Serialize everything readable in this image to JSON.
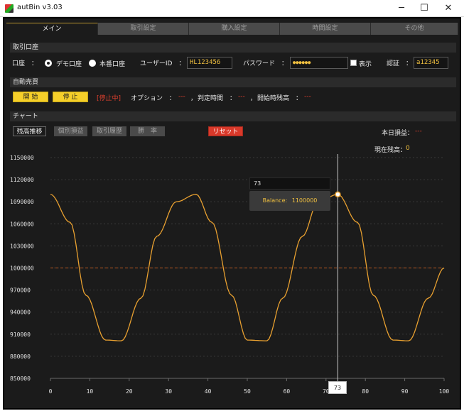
{
  "window": {
    "title": "autBin v3.03",
    "minimize": "─",
    "maximize": "☐",
    "close": "✕"
  },
  "tabs": [
    {
      "label": "メイン",
      "active": true
    },
    {
      "label": "取引設定"
    },
    {
      "label": "購入設定"
    },
    {
      "label": "時間設定"
    },
    {
      "label": "その他"
    }
  ],
  "account": {
    "section_title": "取引口座",
    "account_label": "口座　：",
    "demo_label": "デモ口座",
    "live_label": "本番口座",
    "user_id_label": "ユーザーID　：",
    "user_id_value": "HL123456",
    "password_label": "パスワード　：",
    "password_value": "●●●●●●",
    "show_label": "表示",
    "auth_label": "認証　：",
    "auth_value": "a12345"
  },
  "auto": {
    "section_title": "自動売買",
    "start_label": "開 始",
    "stop_label": "停 止",
    "status": "[停止中]",
    "option_label": "オプション　：",
    "option_value": "---",
    "sep1": "，",
    "judge_label": "判定時間　：",
    "judge_value": "---",
    "sep2": "，",
    "balance_label": "開始時残高　：",
    "balance_value": "---"
  },
  "chart_section": {
    "section_title": "チャート",
    "subtabs": [
      "残高推移",
      "個別損益",
      "取引履歴",
      "勝　率"
    ],
    "reset_label": "リセット",
    "daily_pl_label": "本日損益：",
    "daily_pl_value": "---",
    "current_balance_label": "現在残高：",
    "current_balance_value": "0"
  },
  "tooltip": {
    "x_label": "73",
    "series_label": "Balance:",
    "series_value": "1100000"
  },
  "cursor_label": "73",
  "colors": {
    "accent": "#f0c040",
    "line": "#e8a030",
    "baseline": "#c05a20",
    "reset": "#d9392a",
    "button": "#f5cf2a"
  },
  "chart_data": {
    "type": "line",
    "x_ticks": [
      0,
      10,
      20,
      30,
      40,
      50,
      60,
      70,
      80,
      90,
      100
    ],
    "y_ticks": [
      850000,
      880000,
      910000,
      940000,
      970000,
      1000000,
      1030000,
      1060000,
      1090000,
      1120000,
      1150000
    ],
    "xlim": [
      0,
      100
    ],
    "ylim": [
      850000,
      1150000
    ],
    "series": [
      {
        "values_formula": "1000000 + 100000*cos(2*pi*x/36.5)"
      }
    ],
    "x": [
      0,
      5,
      9,
      14,
      18,
      23,
      27,
      32,
      37,
      41,
      46,
      50,
      55,
      59,
      64,
      68,
      73,
      78,
      82,
      87,
      91,
      96,
      100
    ],
    "y": [
      1100000,
      1062000,
      963000,
      902000,
      901000,
      959000,
      1043000,
      1090000,
      1100000,
      1062000,
      963000,
      902000,
      901000,
      959000,
      1043000,
      1090000,
      1100000,
      1062000,
      963000,
      902000,
      901000,
      959000,
      1000000
    ],
    "baseline": 1000000,
    "cursor_x": 73,
    "grid": true
  }
}
